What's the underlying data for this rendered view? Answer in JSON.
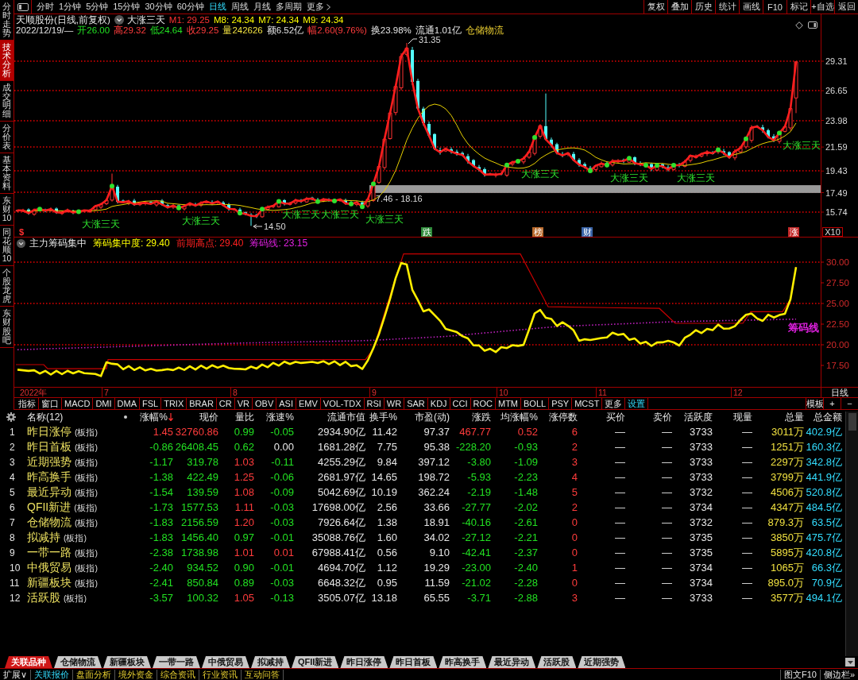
{
  "sidebar": {
    "items": [
      {
        "label": "分时走势",
        "selected": false
      },
      {
        "label": "技术分析",
        "selected": true
      },
      {
        "label": "成交明细",
        "selected": false
      },
      {
        "label": "分价表",
        "selected": false
      },
      {
        "label": "基本资料",
        "selected": false
      },
      {
        "label": "东财10",
        "selected": false
      },
      {
        "label": "同花顺10",
        "selected": false
      },
      {
        "label": "个股龙虎",
        "selected": false
      },
      {
        "label": "东财股吧",
        "selected": false
      }
    ]
  },
  "toolbar": {
    "periods": [
      {
        "label": "分时",
        "selected": false
      },
      {
        "label": "1分钟",
        "selected": false
      },
      {
        "label": "5分钟",
        "selected": false
      },
      {
        "label": "15分钟",
        "selected": false
      },
      {
        "label": "30分钟",
        "selected": false
      },
      {
        "label": "60分钟",
        "selected": false
      },
      {
        "label": "日线",
        "selected": true
      },
      {
        "label": "周线",
        "selected": false
      },
      {
        "label": "月线",
        "selected": false
      },
      {
        "label": "多周期",
        "selected": false
      }
    ],
    "more": "更多",
    "actions": [
      "复权",
      "叠加",
      "历史",
      "统计",
      "画线",
      "F10",
      "标记",
      "+自选",
      "返回"
    ]
  },
  "chart": {
    "title": "天顺股份(日线,前复权)",
    "indicator_name": "大涨三天",
    "averages": [
      {
        "label": "M1: 29.25",
        "color": "#ff3232"
      },
      {
        "label": "M8: 24.34",
        "color": "#ffff00"
      },
      {
        "label": "M7: 24.34",
        "color": "#ffff00"
      },
      {
        "label": "M9: 24.34",
        "color": "#ffff00"
      }
    ],
    "quote": [
      {
        "text": "2022/12/19/—",
        "kind": "plain"
      },
      {
        "text": "开26.00",
        "kind": "fall"
      },
      {
        "text": "高29.32",
        "kind": "rise"
      },
      {
        "text": "低24.64",
        "kind": "fall"
      },
      {
        "text": "收29.25",
        "kind": "rise"
      },
      {
        "text": "量242626",
        "kind": "volume"
      },
      {
        "text": "额6.52亿",
        "kind": "plain"
      },
      {
        "text": "幅2.60(9.76%)",
        "kind": "rise"
      },
      {
        "text": "换23.98%",
        "kind": "plain"
      },
      {
        "text": "流通1.01亿",
        "kind": "plain"
      },
      {
        "text": "仓储物流",
        "kind": "sector"
      }
    ],
    "price_axis": [
      "29.31",
      "26.65",
      "23.98",
      "21.59",
      "19.43",
      "17.49",
      "15.74"
    ],
    "peak_label": "31.35",
    "low_label": "14.50",
    "range_label": "7.46 - 18.16",
    "signal_labels": [
      "大涨三天",
      "大涨三天",
      "大涨三天",
      "大涨三天",
      "大涨三天",
      "大涨三天",
      "大涨三天",
      "大涨三天",
      "大涨三天"
    ],
    "start_marker": "$",
    "events": [
      {
        "label": "跌",
        "color": "#2e8b3a"
      },
      {
        "label": "榜",
        "color": "#b8682a"
      },
      {
        "label": "财",
        "color": "#3a64a8"
      },
      {
        "label": "涨",
        "color": "#c42a2a"
      }
    ],
    "zoom_label": "X10"
  },
  "indicator": {
    "name": "主力筹码集中",
    "values": [
      {
        "label": "筹码集中度: 29.40",
        "color": "#ffff00"
      },
      {
        "label": "前期高点: 29.40",
        "color": "#ff2020"
      },
      {
        "label": "筹码线: 23.15",
        "color": "#e020e0"
      }
    ],
    "axis": [
      {
        "label": "30.00",
        "grid": true
      },
      {
        "label": "27.50",
        "grid": false
      },
      {
        "label": "25.00",
        "grid": true
      },
      {
        "label": "22.50",
        "grid": false
      },
      {
        "label": "20.00",
        "grid": true
      },
      {
        "label": "17.50",
        "grid": false
      }
    ],
    "end_label": {
      "text": "筹码线",
      "color": "#e020e0"
    }
  },
  "time_axis": {
    "labels": [
      "2022年",
      "7",
      "8",
      "9",
      "10",
      "11",
      "12"
    ],
    "period": "日线"
  },
  "indicator_tabs": [
    {
      "label": "指标",
      "kind": "tab"
    },
    {
      "label": "窗口",
      "kind": "tab"
    },
    {
      "label": "MACD",
      "kind": "tab"
    },
    {
      "label": "DMI",
      "kind": "tab"
    },
    {
      "label": "DMA",
      "kind": "tab"
    },
    {
      "label": "FSL",
      "kind": "tab"
    },
    {
      "label": "TRIX",
      "kind": "tab"
    },
    {
      "label": "BRAR",
      "kind": "tab"
    },
    {
      "label": "CR",
      "kind": "tab"
    },
    {
      "label": "VR",
      "kind": "tab"
    },
    {
      "label": "OBV",
      "kind": "tab"
    },
    {
      "label": "ASI",
      "kind": "tab"
    },
    {
      "label": "EMV",
      "kind": "tab"
    },
    {
      "label": "VOL-TDX",
      "kind": "tab"
    },
    {
      "label": "RSI",
      "kind": "tab"
    },
    {
      "label": "WR",
      "kind": "tab"
    },
    {
      "label": "SAR",
      "kind": "tab"
    },
    {
      "label": "KDJ",
      "kind": "tab"
    },
    {
      "label": "CCI",
      "kind": "tab"
    },
    {
      "label": "ROC",
      "kind": "tab"
    },
    {
      "label": "MTM",
      "kind": "tab"
    },
    {
      "label": "BOLL",
      "kind": "tab"
    },
    {
      "label": "PSY",
      "kind": "tab"
    },
    {
      "label": "MCST",
      "kind": "tab"
    },
    {
      "label": "更多",
      "kind": "tab"
    },
    {
      "label": "设置",
      "kind": "action"
    }
  ],
  "window_buttons": [
    "模板",
    "+",
    "−"
  ],
  "table": {
    "name_column": "名称(12)",
    "columns": [
      {
        "label": "涨幅%",
        "kind": "change",
        "sorted": true
      },
      {
        "label": "现价",
        "kind": "price",
        "sorted": false
      },
      {
        "label": "量比",
        "kind": "ratio",
        "sorted": false
      },
      {
        "label": "涨速%",
        "kind": "change",
        "sorted": false
      },
      {
        "label": "流通市值",
        "kind": "plain",
        "sorted": false
      },
      {
        "label": "换手%",
        "kind": "plain",
        "sorted": false
      },
      {
        "label": "市盈(动)",
        "kind": "plain",
        "sorted": false
      },
      {
        "label": "涨跌",
        "kind": "change",
        "sorted": false
      },
      {
        "label": "均涨幅%",
        "kind": "change",
        "sorted": false
      },
      {
        "label": "涨停数",
        "kind": "count",
        "sorted": false
      },
      {
        "label": "买价",
        "kind": "plain",
        "sorted": false
      },
      {
        "label": "卖价",
        "kind": "plain",
        "sorted": false
      },
      {
        "label": "活跃度",
        "kind": "plain",
        "sorted": false
      },
      {
        "label": "现量",
        "kind": "plain",
        "sorted": false
      },
      {
        "label": "总量",
        "kind": "volume",
        "sorted": false
      },
      {
        "label": "总金额",
        "kind": "amount",
        "sorted": false
      }
    ],
    "rows": [
      {
        "index": "1",
        "name": "昨日涨停",
        "tag": "(板指)",
        "cells": [
          "1.45",
          "32760.86",
          "0.99",
          "-0.05",
          "2934.90亿",
          "11.42",
          "97.37",
          "467.77",
          "0.52",
          "6",
          "—",
          "—",
          "3733",
          "—",
          "3011万",
          "402.9亿"
        ]
      },
      {
        "index": "2",
        "name": "昨日首板",
        "tag": "(板指)",
        "cells": [
          "-0.86",
          "26408.45",
          "0.62",
          "0.00",
          "1681.28亿",
          "7.75",
          "95.38",
          "-228.20",
          "-0.93",
          "2",
          "—",
          "—",
          "3733",
          "—",
          "1251万",
          "160.3亿"
        ]
      },
      {
        "index": "3",
        "name": "近期强势",
        "tag": "(板指)",
        "cells": [
          "-1.17",
          "319.78",
          "1.03",
          "-0.11",
          "4255.29亿",
          "9.84",
          "397.12",
          "-3.80",
          "-1.09",
          "3",
          "—",
          "—",
          "3733",
          "—",
          "2297万",
          "342.8亿"
        ]
      },
      {
        "index": "4",
        "name": "昨高换手",
        "tag": "(板指)",
        "cells": [
          "-1.38",
          "422.49",
          "1.25",
          "-0.06",
          "2681.97亿",
          "14.65",
          "198.72",
          "-5.93",
          "-2.23",
          "4",
          "—",
          "—",
          "3733",
          "—",
          "3799万",
          "441.9亿"
        ]
      },
      {
        "index": "5",
        "name": "最近异动",
        "tag": "(板指)",
        "cells": [
          "-1.54",
          "139.59",
          "1.08",
          "-0.09",
          "5042.69亿",
          "10.19",
          "362.24",
          "-2.19",
          "-1.48",
          "5",
          "—",
          "—",
          "3732",
          "—",
          "4506万",
          "520.8亿"
        ]
      },
      {
        "index": "6",
        "name": "QFII新进",
        "tag": "(板指)",
        "cells": [
          "-1.73",
          "1577.53",
          "1.11",
          "-0.03",
          "17698.00亿",
          "2.56",
          "33.66",
          "-27.77",
          "-2.02",
          "2",
          "—",
          "—",
          "3734",
          "—",
          "4347万",
          "484.5亿"
        ]
      },
      {
        "index": "7",
        "name": "仓储物流",
        "tag": "(板指)",
        "cells": [
          "-1.83",
          "2156.59",
          "1.20",
          "-0.03",
          "7926.64亿",
          "1.38",
          "18.91",
          "-40.16",
          "-2.61",
          "0",
          "—",
          "—",
          "3732",
          "—",
          "879.3万",
          "63.5亿"
        ]
      },
      {
        "index": "8",
        "name": "拟减持",
        "tag": "(板指)",
        "cells": [
          "-1.83",
          "1456.40",
          "0.97",
          "-0.01",
          "35088.76亿",
          "1.60",
          "34.02",
          "-27.12",
          "-2.21",
          "0",
          "—",
          "—",
          "3735",
          "—",
          "3850万",
          "475.7亿"
        ]
      },
      {
        "index": "9",
        "name": "一带一路",
        "tag": "(板指)",
        "cells": [
          "-2.38",
          "1738.98",
          "1.01",
          "0.01",
          "67988.41亿",
          "0.56",
          "9.10",
          "-42.41",
          "-2.37",
          "0",
          "—",
          "—",
          "3735",
          "—",
          "5895万",
          "420.8亿"
        ]
      },
      {
        "index": "10",
        "name": "中俄贸易",
        "tag": "(板指)",
        "cells": [
          "-2.40",
          "934.52",
          "0.90",
          "-0.01",
          "4694.70亿",
          "1.12",
          "19.29",
          "-23.00",
          "-2.40",
          "1",
          "—",
          "—",
          "3734",
          "—",
          "1065万",
          "66.3亿"
        ]
      },
      {
        "index": "11",
        "name": "新疆板块",
        "tag": "(板指)",
        "cells": [
          "-2.41",
          "850.84",
          "0.89",
          "-0.03",
          "6648.32亿",
          "0.95",
          "11.59",
          "-21.02",
          "-2.28",
          "0",
          "—",
          "—",
          "3734",
          "—",
          "895.0万",
          "70.9亿"
        ]
      },
      {
        "index": "12",
        "name": "活跃股",
        "tag": "(板指)",
        "cells": [
          "-3.57",
          "100.32",
          "1.05",
          "-0.13",
          "3505.07亿",
          "13.18",
          "65.55",
          "-3.71",
          "-2.88",
          "3",
          "—",
          "—",
          "3733",
          "—",
          "3577万",
          "494.1亿"
        ]
      }
    ]
  },
  "related_tabs": [
    {
      "label": "关联品种",
      "selected": true
    },
    {
      "label": "仓储物流",
      "selected": false
    },
    {
      "label": "新疆板块",
      "selected": false
    },
    {
      "label": "一带一路",
      "selected": false
    },
    {
      "label": "中俄贸易",
      "selected": false
    },
    {
      "label": "拟减持",
      "selected": false
    },
    {
      "label": "QFII新进",
      "selected": false
    },
    {
      "label": "昨日涨停",
      "selected": false
    },
    {
      "label": "昨日首板",
      "selected": false
    },
    {
      "label": "昨高换手",
      "selected": false
    },
    {
      "label": "最近异动",
      "selected": false
    },
    {
      "label": "活跃股",
      "selected": false
    },
    {
      "label": "近期强势",
      "selected": false
    }
  ],
  "status_bar": {
    "items": [
      {
        "label": "扩展∨",
        "kind": "toggle",
        "selected": false
      },
      {
        "label": "关联报价",
        "kind": "tab",
        "selected": true
      },
      {
        "label": "盘面分析",
        "kind": "tab",
        "selected": false
      },
      {
        "label": "境外资金",
        "kind": "tab",
        "selected": false
      },
      {
        "label": "综合资讯",
        "kind": "tab",
        "selected": false
      },
      {
        "label": "行业资讯",
        "kind": "tab",
        "selected": false
      },
      {
        "label": "互动问答",
        "kind": "tab",
        "selected": false
      }
    ],
    "right": [
      "图文F10",
      "侧边栏»"
    ]
  }
}
